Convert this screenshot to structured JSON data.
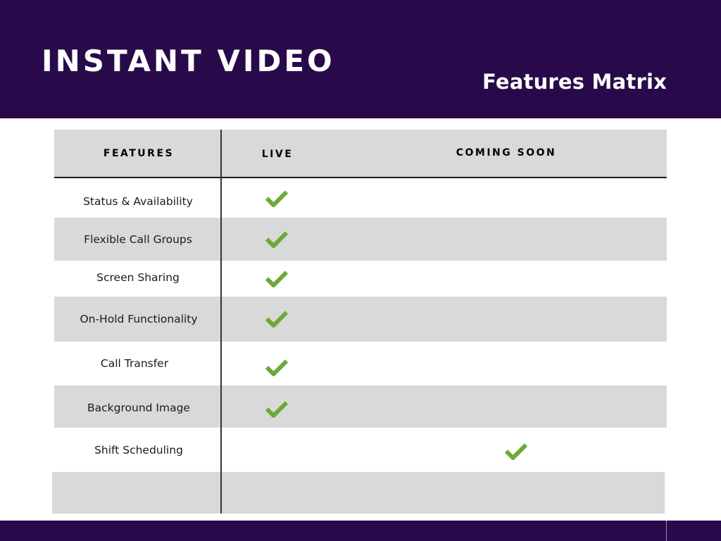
{
  "header": {
    "title": "INSTANT VIDEO",
    "subtitle": "Features Matrix"
  },
  "table": {
    "columns": [
      "FEATURES",
      "LIVE",
      "COMING SOON"
    ],
    "rows": [
      {
        "feature": "Status & Availability",
        "live": true,
        "coming_soon": false
      },
      {
        "feature": "Flexible Call Groups",
        "live": true,
        "coming_soon": false
      },
      {
        "feature": "Screen Sharing",
        "live": true,
        "coming_soon": false
      },
      {
        "feature": "On-Hold Functionality",
        "live": true,
        "coming_soon": false
      },
      {
        "feature": "Call Transfer",
        "live": true,
        "coming_soon": false
      },
      {
        "feature": "Background Image",
        "live": true,
        "coming_soon": false
      },
      {
        "feature": "Shift Scheduling",
        "live": false,
        "coming_soon": true
      },
      {
        "feature": "",
        "live": false,
        "coming_soon": false
      }
    ],
    "check_icon": "check-icon"
  },
  "colors": {
    "brand_purple": "#280a4a",
    "row_band_gray": "#d9d9d9",
    "check_green": "#6aab35",
    "title_text": "#ffffff"
  }
}
